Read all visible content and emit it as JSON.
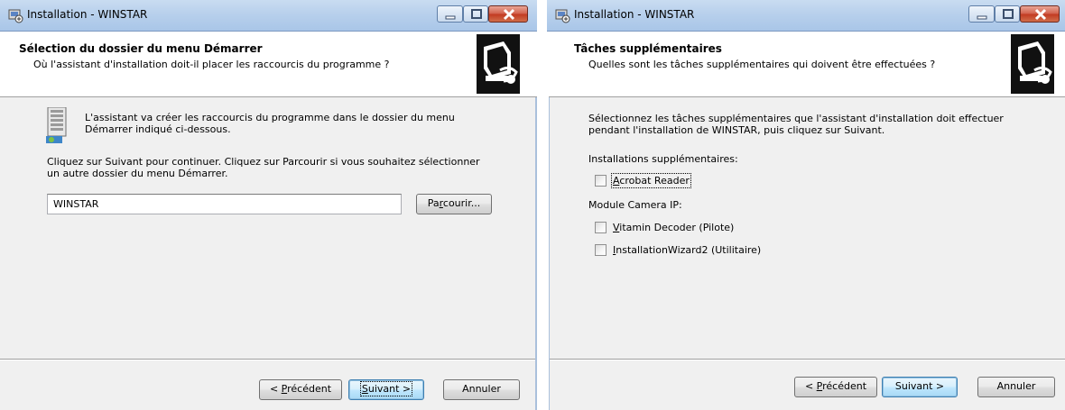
{
  "window1": {
    "title": "Installation - WINSTAR",
    "header": {
      "title": "Sélection du dossier du menu Démarrer",
      "subtitle": "Où l'assistant d'installation doit-il placer les raccourcis du programme ?"
    },
    "body": {
      "intro_lines": [
        "L'assistant va créer les raccourcis du programme dans le dossier du menu",
        "Démarrer indiqué ci-dessous."
      ],
      "instruction_lines": [
        "Cliquez sur Suivant pour continuer. Cliquez sur Parcourir si vous souhaitez sélectionner",
        "un autre dossier du menu Démarrer."
      ],
      "folder_input_value": "WINSTAR",
      "browse_button": {
        "pre": "Pa",
        "u": "r",
        "post": "courir..."
      }
    },
    "footer": {
      "back_button": {
        "pre": "< ",
        "u": "P",
        "post": "récédent"
      },
      "next_button": {
        "pre": "",
        "u": "S",
        "post": "uivant >"
      },
      "cancel_button": "Annuler"
    }
  },
  "window2": {
    "title": "Installation - WINSTAR",
    "header": {
      "title": "Tâches supplémentaires",
      "subtitle": "Quelles sont les tâches supplémentaires qui doivent être effectuées ?"
    },
    "body": {
      "intro_lines": [
        "Sélectionnez les tâches supplémentaires que l'assistant d'installation doit effectuer",
        "pendant l'installation de WINSTAR, puis cliquez sur Suivant."
      ],
      "group1_label": "Installations supplémentaires:",
      "acrobat": {
        "u": "A",
        "post": "crobat Reader",
        "checked": false
      },
      "group2_label": "Module Camera IP:",
      "vitamin": {
        "u": "V",
        "post": "itamin Decoder (Pilote)",
        "checked": false
      },
      "wizard": {
        "u": "I",
        "post": "nstallationWizard2 (Utilitaire)",
        "checked": false
      }
    },
    "footer": {
      "back_button": {
        "pre": "< ",
        "u": "P",
        "post": "récédent"
      },
      "next_button": "Suivant >",
      "cancel_button": "Annuler"
    }
  },
  "colors": {
    "titlebar": "#b8d0ec",
    "content_bg": "#f0f0f0",
    "close_button": "#c23a21",
    "default_button_border": "#3c7fb1"
  },
  "icons": {
    "app": "installer-app-icon",
    "header": "computer-install-icon",
    "folder": "start-menu-folder-icon"
  }
}
